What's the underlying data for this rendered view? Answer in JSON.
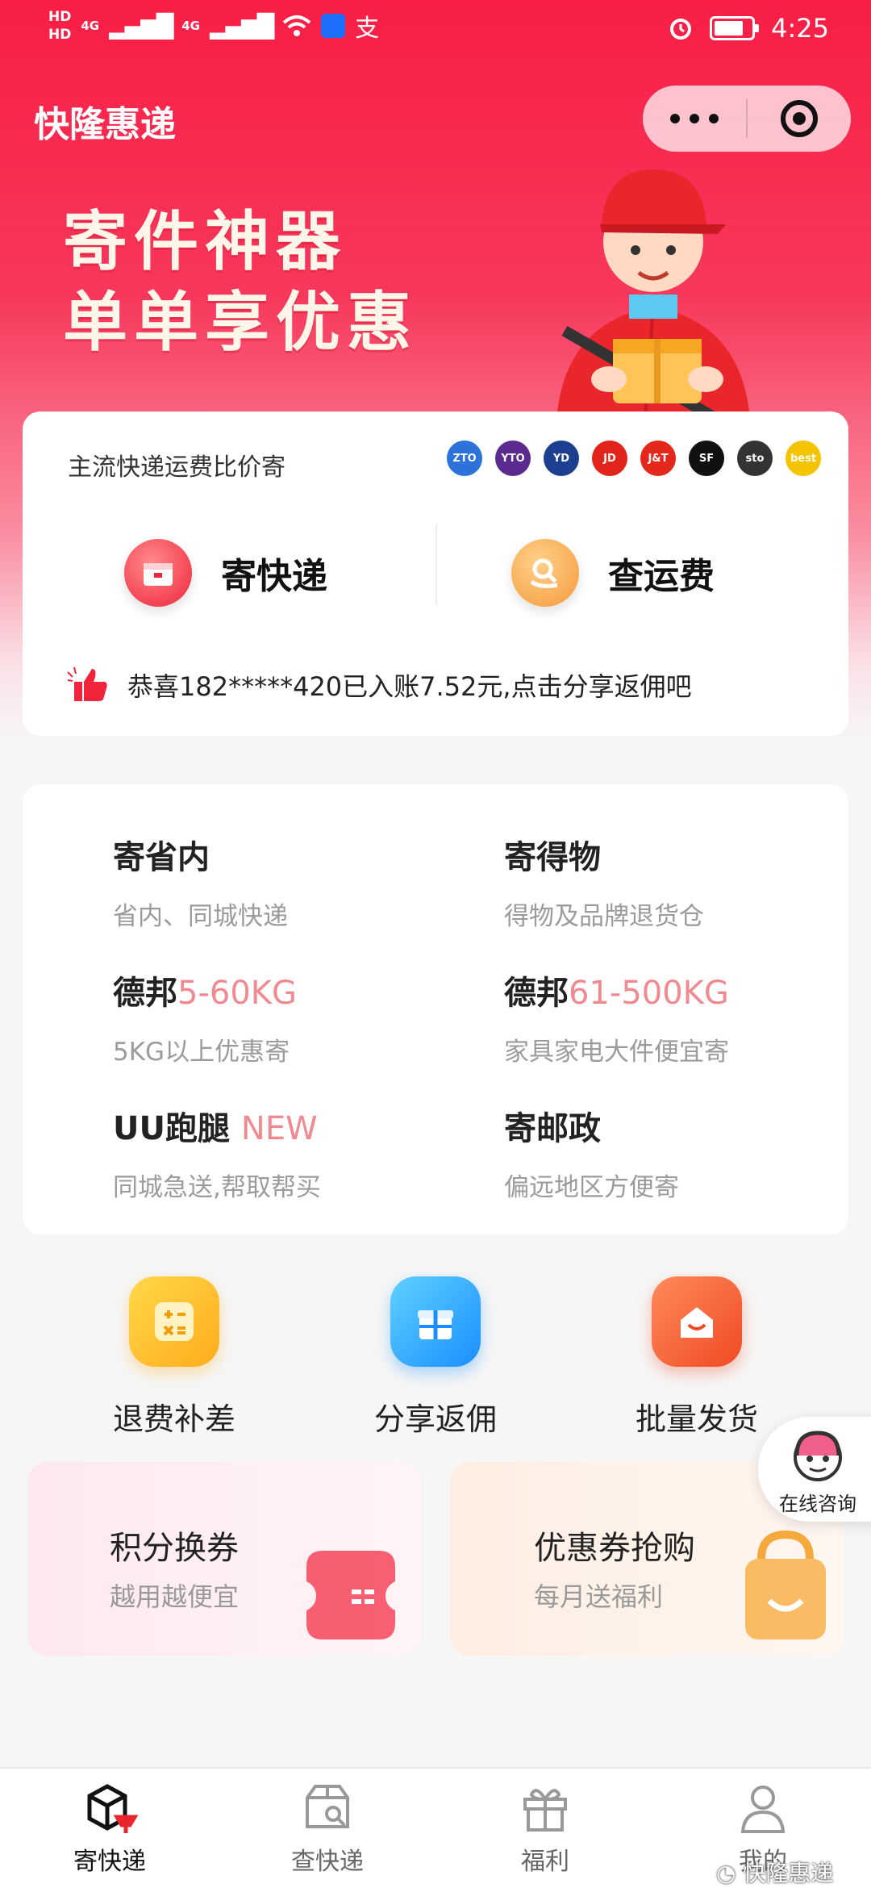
{
  "status_bar": {
    "hd1": "HD",
    "hd2": "HD",
    "network": "4G",
    "time": "4:25",
    "battery_level": 0.8
  },
  "header": {
    "title": "快隆惠递"
  },
  "hero": {
    "slogan_line1": "寄件神器",
    "slogan_line2": "单单享优惠"
  },
  "compare": {
    "title": "主流快递运费比价寄",
    "carriers": [
      {
        "name": "ZTO",
        "color": "#2d72d9"
      },
      {
        "name": "YTO",
        "color": "#5b2a8e"
      },
      {
        "name": "YD",
        "color": "#1d3f8f"
      },
      {
        "name": "JD",
        "color": "#e1251b"
      },
      {
        "name": "J&T",
        "color": "#e5281c"
      },
      {
        "name": "SF",
        "color": "#111111"
      },
      {
        "name": "sto",
        "color": "#333333"
      },
      {
        "name": "best",
        "color": "#f4c400"
      }
    ],
    "send_label": "寄快递",
    "fee_label": "查运费",
    "notice": "恭喜182*****420已入账7.52元,点击分享返佣吧"
  },
  "services": [
    {
      "name": "寄省内",
      "highlight": "",
      "desc": "省内、同城快递"
    },
    {
      "name": "寄得物",
      "highlight": "",
      "desc": "得物及品牌退货仓"
    },
    {
      "name": "德邦",
      "highlight": "5-60KG",
      "desc": "5KG以上优惠寄"
    },
    {
      "name": "德邦",
      "highlight": "61-500KG",
      "desc": "家具家电大件便宜寄"
    },
    {
      "name": "UU跑腿",
      "highlight": "NEW",
      "desc": "同城急送,帮取帮买"
    },
    {
      "name": "寄邮政",
      "highlight": "",
      "desc": "偏远地区方便寄"
    }
  ],
  "shortcuts": [
    {
      "label": "退费补差",
      "icon": "calculator-icon"
    },
    {
      "label": "分享返佣",
      "icon": "gift-icon"
    },
    {
      "label": "批量发货",
      "icon": "inbox-icon"
    }
  ],
  "promos": [
    {
      "title": "积分换券",
      "subtitle": "越用越便宜"
    },
    {
      "title": "优惠券抢购",
      "subtitle": "每月送福利"
    }
  ],
  "consult": {
    "label": "在线咨询"
  },
  "tabs": [
    {
      "label": "寄快递",
      "icon": "parcel-icon",
      "active": true
    },
    {
      "label": "查快递",
      "icon": "package-search-icon",
      "active": false
    },
    {
      "label": "福利",
      "icon": "gift-icon",
      "active": false
    },
    {
      "label": "我的",
      "icon": "user-icon",
      "active": false
    }
  ],
  "watermark": "快隆惠递",
  "colors": {
    "brand": "#f81e45",
    "highlight": "#f08a90"
  }
}
